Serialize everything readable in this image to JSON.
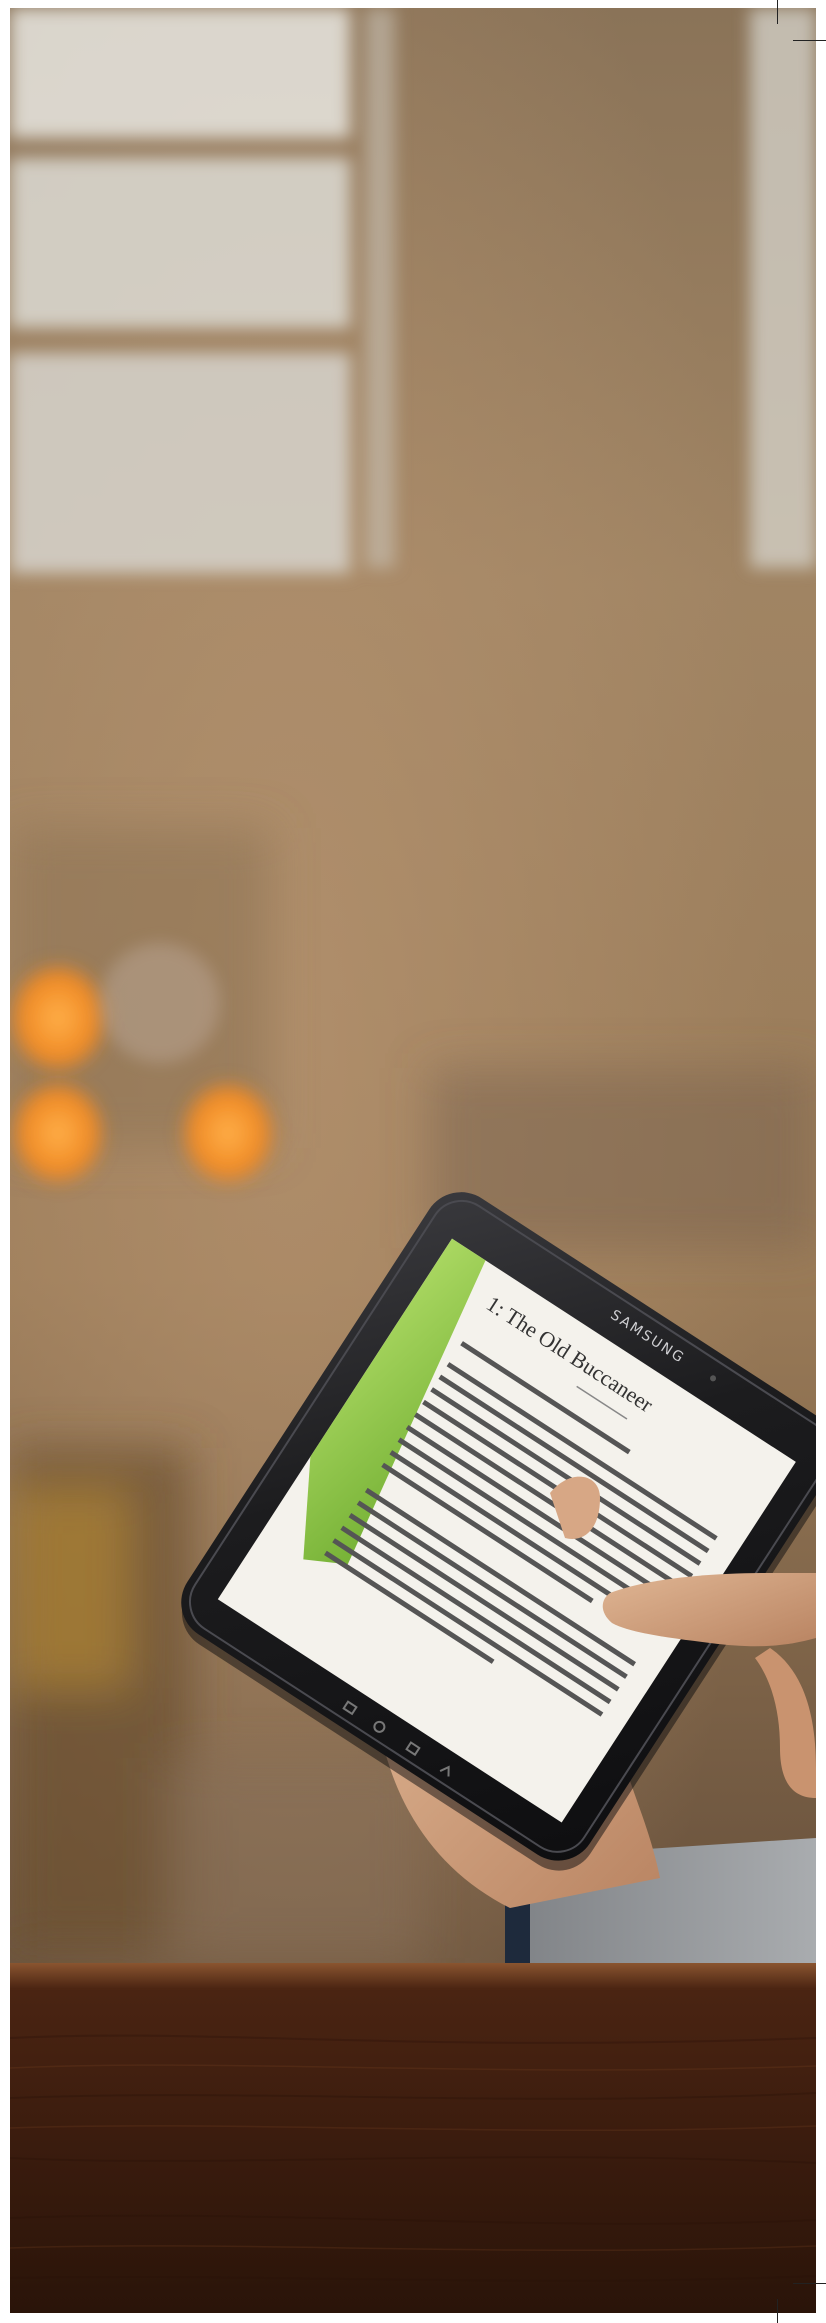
{
  "photo": {
    "description_free": true,
    "tablet": {
      "brand": "SAMSUNG",
      "screen_title": "1: The Old Buccaneer"
    }
  },
  "colors": {
    "background_warm": "#9a7a55",
    "wood_counter": "#4a2412",
    "tablet_body": "#1c1c1e",
    "screen_paper": "#f4f2ec",
    "accent_green": "#8cc63f",
    "bokeh_orange": "#f08a24"
  }
}
